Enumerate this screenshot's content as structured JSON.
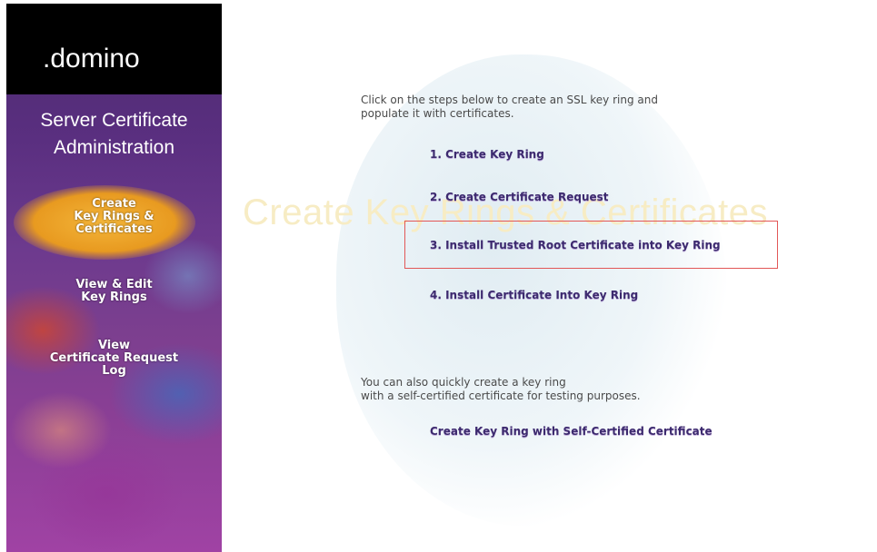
{
  "sidebar": {
    "logo": ".domino",
    "title": "Server Certificate\nAdministration",
    "items": [
      {
        "label": "Create\nKey Rings &\nCertificates",
        "active": true
      },
      {
        "label": "View & Edit\nKey Rings",
        "active": false
      },
      {
        "label": "View\nCertificate Request\nLog",
        "active": false
      }
    ]
  },
  "main": {
    "watermark": "Create Key Rings & Certificates",
    "intro": "Click on the steps below to create an SSL key ring and\npopulate it with certificates.",
    "steps": [
      "1. Create Key Ring",
      "2. Create Certificate Request",
      "3. Install Trusted Root Certificate into Key Ring",
      "4. Install Certificate Into Key Ring"
    ],
    "secondary_text": "You can also quickly create a key ring\nwith a self-certified certificate for testing purposes.",
    "self_certified_link": "Create Key Ring  with Self-Certified Certificate"
  },
  "colors": {
    "link": "#3c2a6e",
    "highlight_box": "#e25757",
    "active_nav": "#f3b53a",
    "watermark": "#f7ecc4"
  }
}
